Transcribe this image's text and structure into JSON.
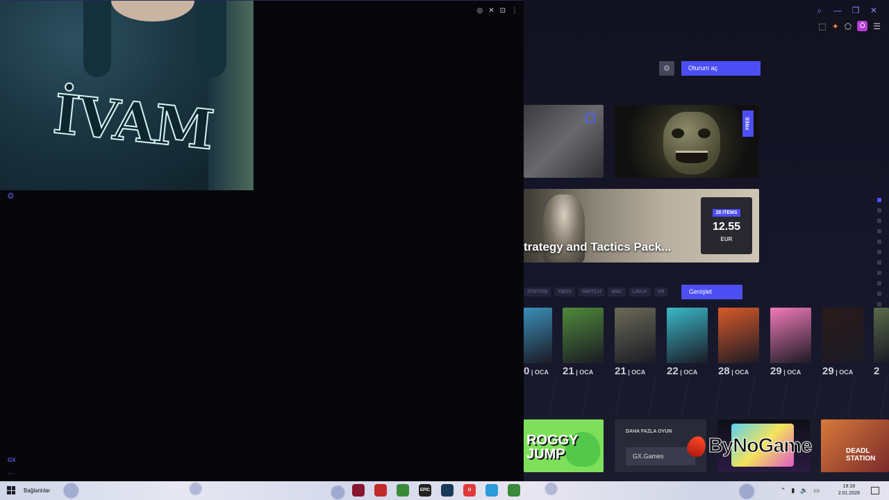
{
  "browser": {
    "window_controls": [
      "⌕",
      "—",
      "❐",
      "✕"
    ],
    "toolbar_icons": [
      "⬚",
      "✦",
      "⬠"
    ],
    "profile_letter": "Ö",
    "menu_icon": "☰"
  },
  "header": {
    "settings_icon": "⚙",
    "login_label": "Oturum aç"
  },
  "featured": {
    "free_badge": "FREE",
    "bundle": {
      "title": "trategy and Tactics Pack...",
      "items_badge": "28 ITEMS",
      "price": "12.55",
      "currency": "EUR"
    }
  },
  "filters": {
    "platforms": [
      "STATION",
      "XBOX",
      "SWITCH",
      "MAC",
      "LINUX",
      "VR"
    ],
    "expand_label": "Genişlet"
  },
  "releases": [
    {
      "day": "0",
      "month": "OCA",
      "color": "#3b8fb8"
    },
    {
      "day": "21",
      "month": "OCA",
      "color": "#4f8a3a"
    },
    {
      "day": "21",
      "month": "OCA",
      "color": "#6a6a58"
    },
    {
      "day": "22",
      "month": "OCA",
      "color": "#3ab8c8"
    },
    {
      "day": "28",
      "month": "OCA",
      "color": "#d85a2a"
    },
    {
      "day": "29",
      "month": "OCA",
      "color": "#f27ab8"
    },
    {
      "day": "29",
      "month": "OCA",
      "color": "#2a1a1a"
    },
    {
      "day": "2",
      "month": "",
      "color": "#5a6a4a"
    }
  ],
  "bottom": {
    "frog_title": "ROGGY\nJUMP",
    "more_games_label": "DAHA FAZLA OYUN",
    "gx_games_label": "GX.Games",
    "deadlock_title": "DEADL\nSTATION"
  },
  "watermark": "ByNoGame",
  "overlay": {
    "controls": [
      "◎",
      "✕",
      "⊡",
      "⋮"
    ],
    "shirt_text": "İVAM",
    "gear_icon": "⚙",
    "gx_label": "GX",
    "more_dots": "⋯"
  },
  "taskbar": {
    "links_label": "Bağlantılar",
    "apps": [
      {
        "name": "opera-gx",
        "label": "",
        "color": "#8a1530"
      },
      {
        "name": "app-2",
        "label": "",
        "color": "#c22a2a"
      },
      {
        "name": "chrome",
        "label": "",
        "color": "#3a8a3a"
      },
      {
        "name": "epic",
        "label": "EPIC",
        "color": "#222"
      },
      {
        "name": "steam",
        "label": "",
        "color": "#1a3a5a"
      },
      {
        "name": "opera",
        "label": "O",
        "color": "#e03a3a"
      },
      {
        "name": "telegram",
        "label": "",
        "color": "#2a9ad8"
      },
      {
        "name": "chrome-2",
        "label": "",
        "color": "#3a8a3a"
      }
    ],
    "tray_icons": [
      "⌃",
      "▮",
      "🔈",
      "▭"
    ],
    "time": "19:18",
    "date": "2.01.2026"
  }
}
